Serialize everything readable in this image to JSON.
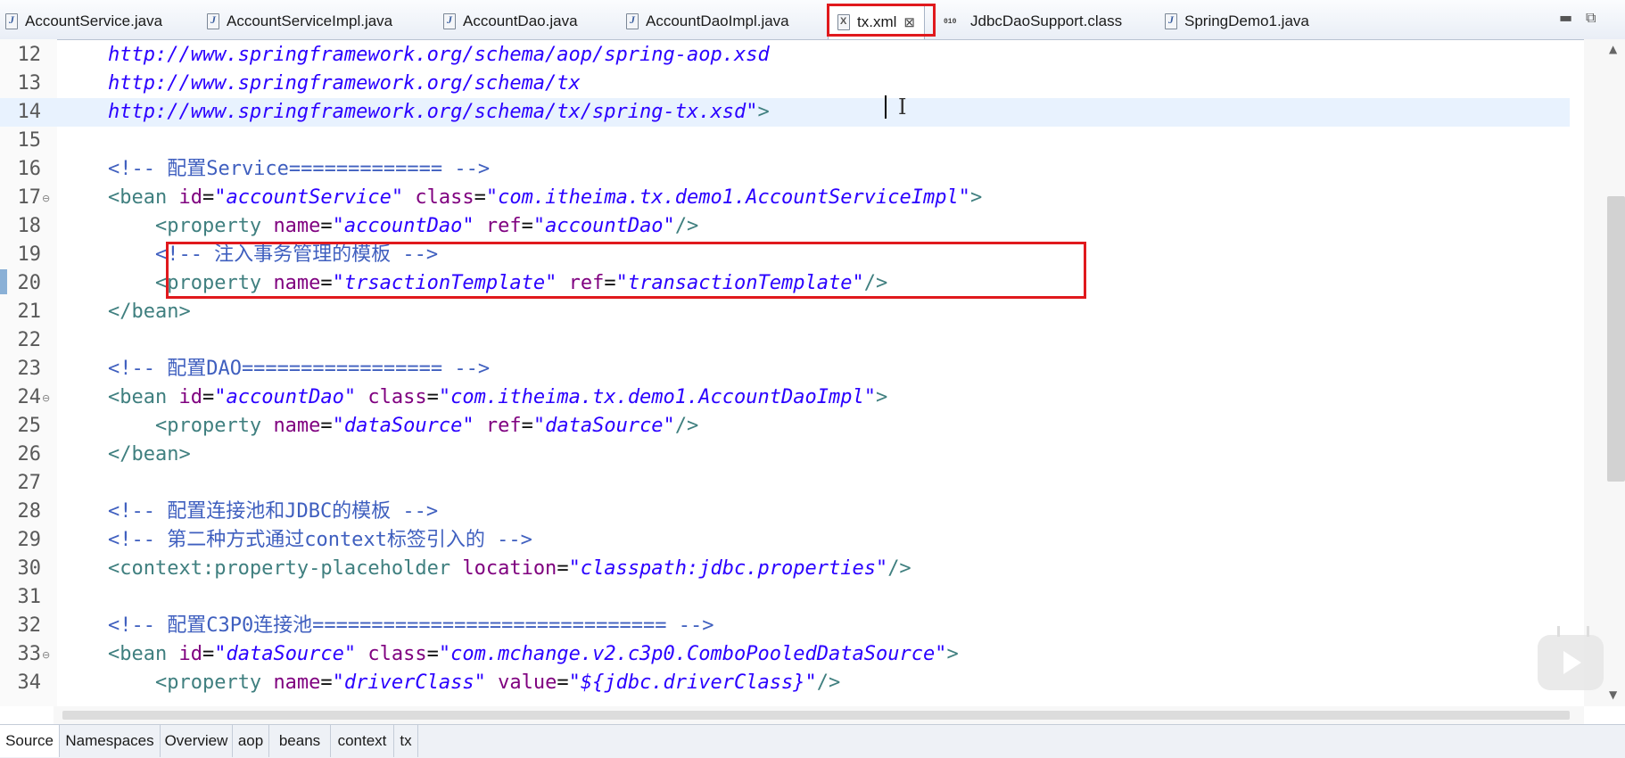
{
  "tabs": [
    {
      "label": "AccountService.java",
      "icon": "java-file-icon"
    },
    {
      "label": "AccountServiceImpl.java",
      "icon": "java-file-icon"
    },
    {
      "label": "AccountDao.java",
      "icon": "java-file-icon"
    },
    {
      "label": "AccountDaoImpl.java",
      "icon": "java-file-icon"
    },
    {
      "label": "tx.xml",
      "icon": "xml-file-icon",
      "close": "⊠"
    },
    {
      "label": "JdbcDaoSupport.class",
      "icon": "class-file-icon"
    },
    {
      "label": "SpringDemo1.java",
      "icon": "java-file-icon"
    }
  ],
  "window": {
    "minimize": "▬",
    "maximize": "⧉"
  },
  "lines": [
    {
      "num": "12",
      "segs": [
        {
          "t": "    ",
          "c": "pu"
        },
        {
          "t": "http://www.springframework.org/schema/aop/spring-aop.xsd",
          "c": "url"
        }
      ]
    },
    {
      "num": "13",
      "segs": [
        {
          "t": "    ",
          "c": "pu"
        },
        {
          "t": "http://www.springframework.org/schema/tx",
          "c": "url"
        }
      ]
    },
    {
      "num": "14",
      "segs": [
        {
          "t": "    ",
          "c": "pu"
        },
        {
          "t": "http://www.springframework.org/schema/tx/spring-tx.xsd\"",
          "c": "url"
        },
        {
          "t": ">",
          "c": "tg"
        }
      ]
    },
    {
      "num": "15",
      "segs": []
    },
    {
      "num": "16",
      "segs": [
        {
          "t": "    <!-- 配置Service============= -->",
          "c": "cm"
        }
      ]
    },
    {
      "num": "17",
      "segs": [
        {
          "t": "    <",
          "c": "tg"
        },
        {
          "t": "bean ",
          "c": "tg"
        },
        {
          "t": "id",
          "c": "at"
        },
        {
          "t": "=",
          "c": "pu"
        },
        {
          "t": "\"accountService\" ",
          "c": "st"
        },
        {
          "t": "class",
          "c": "at"
        },
        {
          "t": "=",
          "c": "pu"
        },
        {
          "t": "\"com.itheima.tx.demo1.AccountServiceImpl\"",
          "c": "st"
        },
        {
          "t": ">",
          "c": "tg"
        }
      ]
    },
    {
      "num": "18",
      "segs": [
        {
          "t": "        <",
          "c": "tg"
        },
        {
          "t": "property ",
          "c": "tg"
        },
        {
          "t": "name",
          "c": "at"
        },
        {
          "t": "=",
          "c": "pu"
        },
        {
          "t": "\"accountDao\" ",
          "c": "st"
        },
        {
          "t": "ref",
          "c": "at"
        },
        {
          "t": "=",
          "c": "pu"
        },
        {
          "t": "\"accountDao\"",
          "c": "st"
        },
        {
          "t": "/>",
          "c": "tg"
        }
      ]
    },
    {
      "num": "19",
      "segs": [
        {
          "t": "        <!-- 注入事务管理的模板 -->",
          "c": "cm"
        }
      ]
    },
    {
      "num": "20",
      "segs": [
        {
          "t": "        <",
          "c": "tg"
        },
        {
          "t": "property ",
          "c": "tg"
        },
        {
          "t": "name",
          "c": "at"
        },
        {
          "t": "=",
          "c": "pu"
        },
        {
          "t": "\"trsactionTemplate\" ",
          "c": "st"
        },
        {
          "t": "ref",
          "c": "at"
        },
        {
          "t": "=",
          "c": "pu"
        },
        {
          "t": "\"transactionTemplate\"",
          "c": "st"
        },
        {
          "t": "/>",
          "c": "tg"
        }
      ]
    },
    {
      "num": "21",
      "segs": [
        {
          "t": "    </",
          "c": "tg"
        },
        {
          "t": "bean",
          "c": "tg"
        },
        {
          "t": ">",
          "c": "tg"
        }
      ]
    },
    {
      "num": "22",
      "segs": []
    },
    {
      "num": "23",
      "segs": [
        {
          "t": "    <!-- 配置DAO================= -->",
          "c": "cm"
        }
      ]
    },
    {
      "num": "24",
      "segs": [
        {
          "t": "    <",
          "c": "tg"
        },
        {
          "t": "bean ",
          "c": "tg"
        },
        {
          "t": "id",
          "c": "at"
        },
        {
          "t": "=",
          "c": "pu"
        },
        {
          "t": "\"accountDao\" ",
          "c": "st"
        },
        {
          "t": "class",
          "c": "at"
        },
        {
          "t": "=",
          "c": "pu"
        },
        {
          "t": "\"com.itheima.tx.demo1.AccountDaoImpl\"",
          "c": "st"
        },
        {
          "t": ">",
          "c": "tg"
        }
      ]
    },
    {
      "num": "25",
      "segs": [
        {
          "t": "        <",
          "c": "tg"
        },
        {
          "t": "property ",
          "c": "tg"
        },
        {
          "t": "name",
          "c": "at"
        },
        {
          "t": "=",
          "c": "pu"
        },
        {
          "t": "\"dataSource\" ",
          "c": "st"
        },
        {
          "t": "ref",
          "c": "at"
        },
        {
          "t": "=",
          "c": "pu"
        },
        {
          "t": "\"dataSource\"",
          "c": "st"
        },
        {
          "t": "/>",
          "c": "tg"
        }
      ]
    },
    {
      "num": "26",
      "segs": [
        {
          "t": "    </",
          "c": "tg"
        },
        {
          "t": "bean",
          "c": "tg"
        },
        {
          "t": ">",
          "c": "tg"
        }
      ]
    },
    {
      "num": "27",
      "segs": []
    },
    {
      "num": "28",
      "segs": [
        {
          "t": "    <!-- 配置连接池和JDBC的模板 -->",
          "c": "cm"
        }
      ]
    },
    {
      "num": "29",
      "segs": [
        {
          "t": "    <!-- 第二种方式通过context标签引入的 -->",
          "c": "cm"
        }
      ]
    },
    {
      "num": "30",
      "segs": [
        {
          "t": "    <",
          "c": "tg"
        },
        {
          "t": "context:property-placeholder ",
          "c": "tg"
        },
        {
          "t": "location",
          "c": "at"
        },
        {
          "t": "=",
          "c": "pu"
        },
        {
          "t": "\"classpath:jdbc.properties\"",
          "c": "st"
        },
        {
          "t": "/>",
          "c": "tg"
        }
      ]
    },
    {
      "num": "31",
      "segs": []
    },
    {
      "num": "32",
      "segs": [
        {
          "t": "    <!-- 配置C3P0连接池============================== -->",
          "c": "cm"
        }
      ]
    },
    {
      "num": "33",
      "segs": [
        {
          "t": "    <",
          "c": "tg"
        },
        {
          "t": "bean ",
          "c": "tg"
        },
        {
          "t": "id",
          "c": "at"
        },
        {
          "t": "=",
          "c": "pu"
        },
        {
          "t": "\"dataSource\" ",
          "c": "st"
        },
        {
          "t": "class",
          "c": "at"
        },
        {
          "t": "=",
          "c": "pu"
        },
        {
          "t": "\"com.mchange.v2.c3p0.ComboPooledDataSource\"",
          "c": "st"
        },
        {
          "t": ">",
          "c": "tg"
        }
      ]
    },
    {
      "num": "34",
      "segs": [
        {
          "t": "        <",
          "c": "tg"
        },
        {
          "t": "property ",
          "c": "tg"
        },
        {
          "t": "name",
          "c": "at"
        },
        {
          "t": "=",
          "c": "pu"
        },
        {
          "t": "\"driverClass\" ",
          "c": "st"
        },
        {
          "t": "value",
          "c": "at"
        },
        {
          "t": "=",
          "c": "pu"
        },
        {
          "t": "\"${jdbc.driverClass}\"",
          "c": "st"
        },
        {
          "t": "/>",
          "c": "tg"
        }
      ]
    }
  ],
  "bottom_tabs": [
    "Source",
    "Namespaces",
    "Overview",
    "aop",
    "beans",
    "context",
    "tx"
  ],
  "colors": {
    "highlight_box": "#e0191d",
    "comment": "#3f5fbf",
    "tag": "#3f7f7f",
    "attribute": "#7f007f",
    "string": "#2a00ff"
  }
}
